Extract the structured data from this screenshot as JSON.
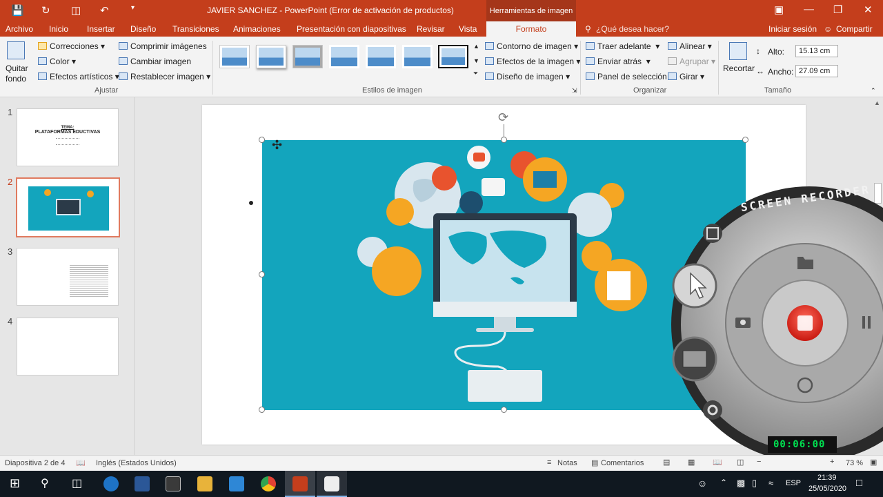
{
  "titlebar": {
    "title": "JAVIER SANCHEZ - PowerPoint (Error de activación de productos)",
    "context_tab": "Herramientas de imagen"
  },
  "tabs": [
    "Archivo",
    "Inicio",
    "Insertar",
    "Diseño",
    "Transiciones",
    "Animaciones",
    "Presentación con diapositivas",
    "Revisar",
    "Vista"
  ],
  "active_tab": "Formato",
  "tellme": "¿Qué desea hacer?",
  "signin": "Iniciar sesión",
  "share": "Compartir",
  "ribbon": {
    "quitar_fondo_1": "Quitar",
    "quitar_fondo_2": "fondo",
    "correcciones": "Correcciones",
    "color": "Color",
    "efectos_artisticos": "Efectos artísticos",
    "comprimir": "Comprimir imágenes",
    "cambiar": "Cambiar imagen",
    "restablecer": "Restablecer imagen",
    "ajustar": "Ajustar",
    "estilos": "Estilos de imagen",
    "contorno": "Contorno de imagen",
    "efectos": "Efectos de la imagen",
    "diseno": "Diseño de imagen",
    "traer": "Traer adelante",
    "enviar": "Enviar atrás",
    "panel": "Panel de selección",
    "alinear": "Alinear",
    "agrupar": "Agrupar",
    "girar": "Girar",
    "organizar": "Organizar",
    "recortar": "Recortar",
    "alto_label": "Alto:",
    "alto_value": "15.13 cm",
    "ancho_label": "Ancho:",
    "ancho_value": "27.09 cm",
    "tamano": "Tamaño"
  },
  "slides": [
    {
      "num": "1",
      "title": "TEMA:",
      "subtitle": "PLATAFORMAS EDUCTIVAS"
    },
    {
      "num": "2"
    },
    {
      "num": "3"
    },
    {
      "num": "4"
    }
  ],
  "status": {
    "slide": "Diapositiva 2 de 4",
    "language": "Inglés (Estados Unidos)",
    "notes": "Notas",
    "comments": "Comentarios",
    "zoom": "73 %"
  },
  "recorder": {
    "title": "SCREEN RECORDER",
    "timer": "00:06:00"
  },
  "taskbar": {
    "lang": "ESP",
    "time": "21:39",
    "date": "25/05/2020"
  },
  "colors": {
    "accent": "#c43e1c",
    "picture_bg": "#13a5bd",
    "timer": "#00e050"
  }
}
